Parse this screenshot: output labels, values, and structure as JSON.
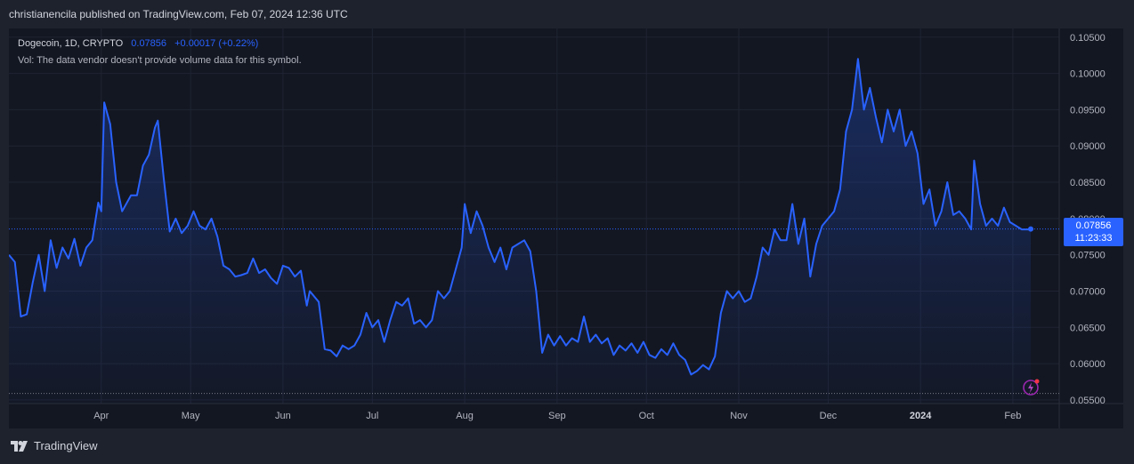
{
  "header": {
    "published_text": "christianencila published on TradingView.com, Feb 07, 2024 12:36 UTC"
  },
  "legend": {
    "symbol_text": "Dogecoin, 1D, CRYPTO",
    "price": "0.07856",
    "change": "+0.00017 (+0.22%)",
    "vol_text": "Vol: The data vendor doesn't provide volume data for this symbol."
  },
  "price_tag": {
    "price": "0.07856",
    "countdown": "11:23:33"
  },
  "footer": {
    "brand": "TradingView"
  },
  "colors": {
    "background": "#131722",
    "line": "#2962ff",
    "grid": "#1f2433",
    "text": "#b2b5be"
  },
  "chart_data": {
    "type": "area",
    "title": "Dogecoin, 1D, CRYPTO",
    "xlabel": "",
    "ylabel": "",
    "ylim": [
      0.0545,
      0.1062
    ],
    "grid": true,
    "legend": "top-left",
    "x_ticks": [
      {
        "label": "Apr",
        "date": "2023-04-01"
      },
      {
        "label": "May",
        "date": "2023-05-01"
      },
      {
        "label": "Jun",
        "date": "2023-06-01"
      },
      {
        "label": "Jul",
        "date": "2023-07-01"
      },
      {
        "label": "Aug",
        "date": "2023-08-01"
      },
      {
        "label": "Sep",
        "date": "2023-09-01"
      },
      {
        "label": "Oct",
        "date": "2023-10-01"
      },
      {
        "label": "Nov",
        "date": "2023-11-01"
      },
      {
        "label": "Dec",
        "date": "2023-12-01"
      },
      {
        "label": "2024",
        "date": "2024-01-01"
      },
      {
        "label": "Feb",
        "date": "2024-02-01"
      }
    ],
    "y_ticks": [
      "0.05500",
      "0.06000",
      "0.06500",
      "0.07000",
      "0.07500",
      "0.08000",
      "0.08500",
      "0.09000",
      "0.09500",
      "0.10000",
      "0.10500"
    ],
    "last_value": 0.07856,
    "lowest_value": 0.0559,
    "series": [
      {
        "values": [
          [
            "2023-03-01",
            0.075
          ],
          [
            "2023-03-03",
            0.074
          ],
          [
            "2023-03-05",
            0.0665
          ],
          [
            "2023-03-07",
            0.0668
          ],
          [
            "2023-03-09",
            0.0712
          ],
          [
            "2023-03-11",
            0.075
          ],
          [
            "2023-03-13",
            0.07
          ],
          [
            "2023-03-15",
            0.077
          ],
          [
            "2023-03-17",
            0.0732
          ],
          [
            "2023-03-19",
            0.076
          ],
          [
            "2023-03-21",
            0.0745
          ],
          [
            "2023-03-23",
            0.0772
          ],
          [
            "2023-03-25",
            0.0735
          ],
          [
            "2023-03-27",
            0.076
          ],
          [
            "2023-03-29",
            0.077
          ],
          [
            "2023-03-31",
            0.0822
          ],
          [
            "2023-04-01",
            0.081
          ],
          [
            "2023-04-02",
            0.096
          ],
          [
            "2023-04-04",
            0.093
          ],
          [
            "2023-04-06",
            0.085
          ],
          [
            "2023-04-08",
            0.081
          ],
          [
            "2023-04-11",
            0.0832
          ],
          [
            "2023-04-13",
            0.0832
          ],
          [
            "2023-04-15",
            0.0873
          ],
          [
            "2023-04-17",
            0.0888
          ],
          [
            "2023-04-19",
            0.0925
          ],
          [
            "2023-04-20",
            0.0935
          ],
          [
            "2023-04-22",
            0.0855
          ],
          [
            "2023-04-24",
            0.0782
          ],
          [
            "2023-04-26",
            0.08
          ],
          [
            "2023-04-28",
            0.078
          ],
          [
            "2023-04-30",
            0.079
          ],
          [
            "2023-05-02",
            0.081
          ],
          [
            "2023-05-04",
            0.079
          ],
          [
            "2023-05-06",
            0.0785
          ],
          [
            "2023-05-08",
            0.08
          ],
          [
            "2023-05-10",
            0.0775
          ],
          [
            "2023-05-12",
            0.0735
          ],
          [
            "2023-05-14",
            0.073
          ],
          [
            "2023-05-16",
            0.072
          ],
          [
            "2023-05-18",
            0.0722
          ],
          [
            "2023-05-20",
            0.0725
          ],
          [
            "2023-05-22",
            0.0745
          ],
          [
            "2023-05-24",
            0.0725
          ],
          [
            "2023-05-26",
            0.073
          ],
          [
            "2023-05-28",
            0.0718
          ],
          [
            "2023-05-30",
            0.071
          ],
          [
            "2023-06-01",
            0.0735
          ],
          [
            "2023-06-03",
            0.0732
          ],
          [
            "2023-06-05",
            0.072
          ],
          [
            "2023-06-07",
            0.0728
          ],
          [
            "2023-06-09",
            0.068
          ],
          [
            "2023-06-10",
            0.07
          ],
          [
            "2023-06-13",
            0.0685
          ],
          [
            "2023-06-15",
            0.062
          ],
          [
            "2023-06-17",
            0.0618
          ],
          [
            "2023-06-19",
            0.061
          ],
          [
            "2023-06-21",
            0.0625
          ],
          [
            "2023-06-23",
            0.062
          ],
          [
            "2023-06-25",
            0.0625
          ],
          [
            "2023-06-27",
            0.064
          ],
          [
            "2023-06-29",
            0.067
          ],
          [
            "2023-07-01",
            0.065
          ],
          [
            "2023-07-03",
            0.066
          ],
          [
            "2023-07-05",
            0.063
          ],
          [
            "2023-07-07",
            0.066
          ],
          [
            "2023-07-09",
            0.0685
          ],
          [
            "2023-07-11",
            0.068
          ],
          [
            "2023-07-13",
            0.069
          ],
          [
            "2023-07-15",
            0.0655
          ],
          [
            "2023-07-17",
            0.066
          ],
          [
            "2023-07-19",
            0.065
          ],
          [
            "2023-07-21",
            0.066
          ],
          [
            "2023-07-23",
            0.07
          ],
          [
            "2023-07-25",
            0.069
          ],
          [
            "2023-07-27",
            0.07
          ],
          [
            "2023-07-29",
            0.073
          ],
          [
            "2023-07-31",
            0.076
          ],
          [
            "2023-08-01",
            0.082
          ],
          [
            "2023-08-03",
            0.078
          ],
          [
            "2023-08-05",
            0.081
          ],
          [
            "2023-08-07",
            0.079
          ],
          [
            "2023-08-09",
            0.076
          ],
          [
            "2023-08-11",
            0.074
          ],
          [
            "2023-08-13",
            0.076
          ],
          [
            "2023-08-15",
            0.073
          ],
          [
            "2023-08-17",
            0.076
          ],
          [
            "2023-08-19",
            0.0765
          ],
          [
            "2023-08-21",
            0.077
          ],
          [
            "2023-08-23",
            0.0755
          ],
          [
            "2023-08-25",
            0.07
          ],
          [
            "2023-08-27",
            0.0615
          ],
          [
            "2023-08-29",
            0.064
          ],
          [
            "2023-08-31",
            0.0625
          ],
          [
            "2023-09-02",
            0.0638
          ],
          [
            "2023-09-04",
            0.0625
          ],
          [
            "2023-09-06",
            0.0635
          ],
          [
            "2023-09-08",
            0.063
          ],
          [
            "2023-09-10",
            0.0665
          ],
          [
            "2023-09-12",
            0.063
          ],
          [
            "2023-09-14",
            0.064
          ],
          [
            "2023-09-16",
            0.0628
          ],
          [
            "2023-09-18",
            0.0635
          ],
          [
            "2023-09-20",
            0.0612
          ],
          [
            "2023-09-22",
            0.0625
          ],
          [
            "2023-09-24",
            0.0618
          ],
          [
            "2023-09-26",
            0.0628
          ],
          [
            "2023-09-28",
            0.0615
          ],
          [
            "2023-09-30",
            0.063
          ],
          [
            "2023-10-02",
            0.0612
          ],
          [
            "2023-10-04",
            0.0608
          ],
          [
            "2023-10-06",
            0.062
          ],
          [
            "2023-10-08",
            0.0612
          ],
          [
            "2023-10-10",
            0.0628
          ],
          [
            "2023-10-12",
            0.0612
          ],
          [
            "2023-10-14",
            0.0605
          ],
          [
            "2023-10-16",
            0.0585
          ],
          [
            "2023-10-18",
            0.059
          ],
          [
            "2023-10-20",
            0.0598
          ],
          [
            "2023-10-22",
            0.0592
          ],
          [
            "2023-10-24",
            0.061
          ],
          [
            "2023-10-26",
            0.067
          ],
          [
            "2023-10-28",
            0.07
          ],
          [
            "2023-10-30",
            0.069
          ],
          [
            "2023-11-01",
            0.07
          ],
          [
            "2023-11-03",
            0.0685
          ],
          [
            "2023-11-05",
            0.069
          ],
          [
            "2023-11-07",
            0.072
          ],
          [
            "2023-11-09",
            0.076
          ],
          [
            "2023-11-11",
            0.075
          ],
          [
            "2023-11-13",
            0.0785
          ],
          [
            "2023-11-15",
            0.077
          ],
          [
            "2023-11-17",
            0.077
          ],
          [
            "2023-11-19",
            0.082
          ],
          [
            "2023-11-21",
            0.0765
          ],
          [
            "2023-11-23",
            0.08
          ],
          [
            "2023-11-25",
            0.072
          ],
          [
            "2023-11-27",
            0.0765
          ],
          [
            "2023-11-29",
            0.079
          ],
          [
            "2023-12-01",
            0.08
          ],
          [
            "2023-12-03",
            0.081
          ],
          [
            "2023-12-05",
            0.084
          ],
          [
            "2023-12-07",
            0.092
          ],
          [
            "2023-12-09",
            0.095
          ],
          [
            "2023-12-11",
            0.102
          ],
          [
            "2023-12-13",
            0.095
          ],
          [
            "2023-12-15",
            0.098
          ],
          [
            "2023-12-17",
            0.094
          ],
          [
            "2023-12-19",
            0.0905
          ],
          [
            "2023-12-21",
            0.095
          ],
          [
            "2023-12-23",
            0.092
          ],
          [
            "2023-12-25",
            0.095
          ],
          [
            "2023-12-27",
            0.09
          ],
          [
            "2023-12-29",
            0.092
          ],
          [
            "2023-12-31",
            0.089
          ],
          [
            "2024-01-02",
            0.082
          ],
          [
            "2024-01-04",
            0.084
          ],
          [
            "2024-01-06",
            0.079
          ],
          [
            "2024-01-08",
            0.081
          ],
          [
            "2024-01-10",
            0.085
          ],
          [
            "2024-01-12",
            0.0805
          ],
          [
            "2024-01-14",
            0.081
          ],
          [
            "2024-01-16",
            0.08
          ],
          [
            "2024-01-18",
            0.0785
          ],
          [
            "2024-01-19",
            0.088
          ],
          [
            "2024-01-21",
            0.082
          ],
          [
            "2024-01-23",
            0.079
          ],
          [
            "2024-01-25",
            0.08
          ],
          [
            "2024-01-27",
            0.079
          ],
          [
            "2024-01-29",
            0.0815
          ],
          [
            "2024-01-31",
            0.0795
          ],
          [
            "2024-02-02",
            0.079
          ],
          [
            "2024-02-04",
            0.0785
          ],
          [
            "2024-02-06",
            0.0785
          ],
          [
            "2024-02-07",
            0.07856
          ]
        ]
      }
    ]
  }
}
